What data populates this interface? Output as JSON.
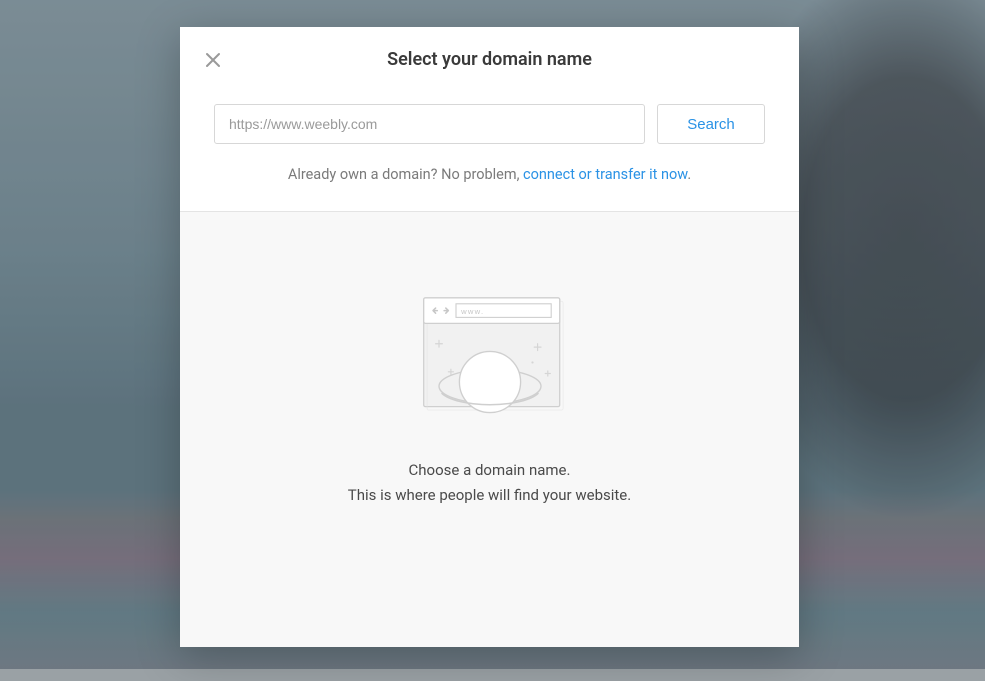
{
  "modal": {
    "title": "Select your domain name",
    "search": {
      "placeholder": "https://www.weebly.com",
      "value": "",
      "button_label": "Search"
    },
    "already_own": {
      "lead_text": "Already own a domain? No problem, ",
      "link_text": "connect or transfer it now",
      "trailing_text": "."
    },
    "illustration": {
      "www_label": "www."
    },
    "empty_state": {
      "line1": "Choose a domain name.",
      "line2": "This is where people will find your website."
    }
  },
  "colors": {
    "accent": "#2a92e5",
    "text_muted": "#7a7a7a",
    "border": "#d7d7d7"
  }
}
